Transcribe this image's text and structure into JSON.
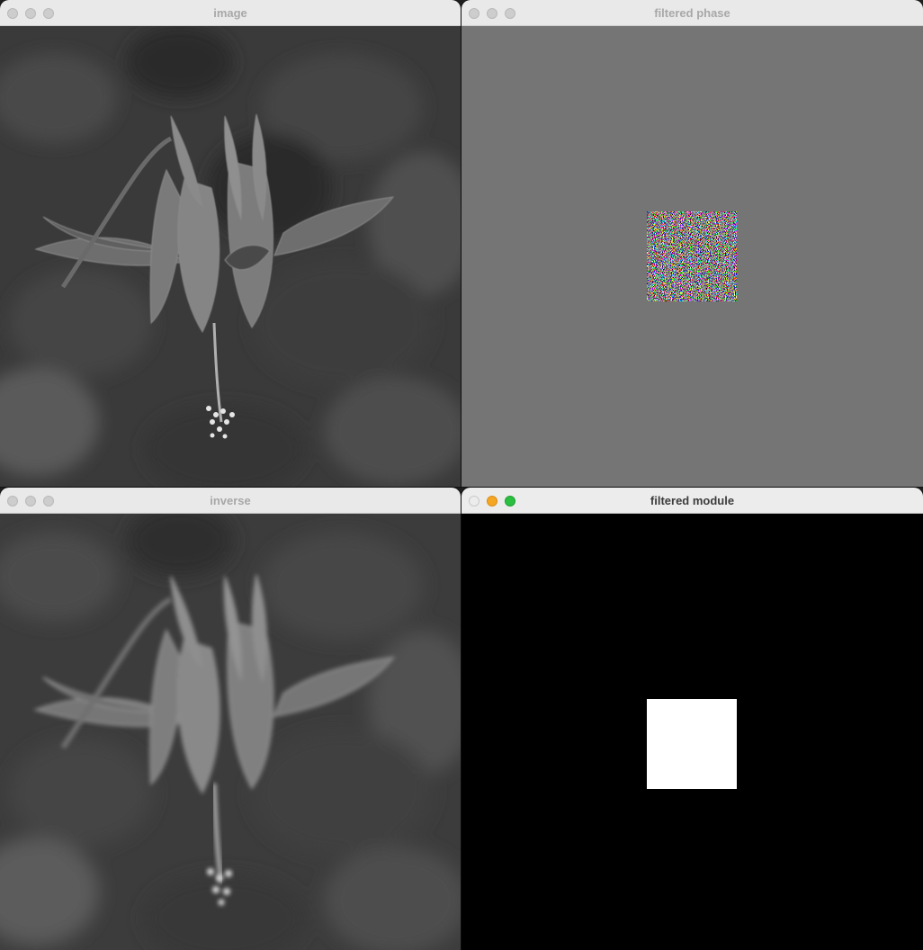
{
  "windows": [
    {
      "id": "image",
      "title": "image",
      "active": false
    },
    {
      "id": "phase",
      "title": "filtered phase",
      "active": false
    },
    {
      "id": "inverse",
      "title": "inverse",
      "active": false
    },
    {
      "id": "module",
      "title": "filtered module",
      "active": true
    }
  ],
  "colors": {
    "phase_background": "#757575",
    "module_background": "#000000",
    "module_mask": "#ffffff",
    "traffic_close_active": "#ececec",
    "traffic_min_active": "#f5a623",
    "traffic_max_active": "#29c03f"
  }
}
